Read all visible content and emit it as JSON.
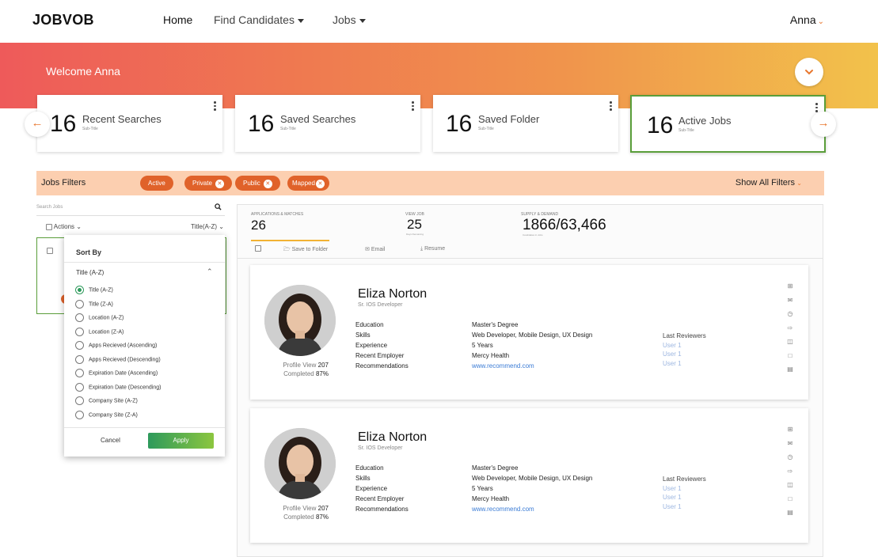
{
  "app": {
    "logo": "JOBVOB"
  },
  "nav": {
    "items": [
      {
        "label": "Home"
      },
      {
        "label": "Find Candidates"
      },
      {
        "label": "Jobs"
      }
    ],
    "user": "Anna"
  },
  "banner": {
    "welcome": "Welcome Anna"
  },
  "cards": [
    {
      "number": "16",
      "title": "Recent Searches",
      "sub": "Sub-Title"
    },
    {
      "number": "16",
      "title": "Saved Searches",
      "sub": "Sub-Title"
    },
    {
      "number": "16",
      "title": "Saved Folder",
      "sub": "Sub-Title"
    },
    {
      "number": "16",
      "title": "Active Jobs",
      "sub": "Sub-Title"
    }
  ],
  "filters": {
    "label": "Jobs Filters",
    "chips": [
      "Active",
      "Private",
      "Public",
      "Mapped"
    ],
    "show_all": "Show All Filters"
  },
  "left": {
    "search_placeholder": "Search Jobs",
    "actions": "Actions",
    "sort_current": "Title(A-Z)"
  },
  "sort": {
    "header": "Sort By",
    "current": "Title (A-Z)",
    "options": [
      "Title (A-Z)",
      "Title (Z-A)",
      "Location (A-Z)",
      "Location (Z-A)",
      "Apps Recieved (Ascending)",
      "Apps Recieved (Descending)",
      "Expiration Date (Ascending)",
      "Expiration Date (Descending)",
      "Company Site (A-Z)",
      "Company Site (Z-A)"
    ],
    "selected_index": 0,
    "cancel": "Cancel",
    "apply": "Apply"
  },
  "stats": {
    "apps_label": "APPLICATIONS & MATCHES",
    "apps_value": "26",
    "view_label": "VIEW JOB",
    "view_value": "25",
    "view_sub": "Days Remaining",
    "supply_label": "SUPPLY & DEMAND",
    "supply_value": "1866/63,466",
    "supply_sub": "Candidates in Jobs"
  },
  "toolbar": {
    "save": "Save to Folder",
    "email": "Email",
    "resume": "Resume"
  },
  "candidates": [
    {
      "name": "Eliza Norton",
      "role": "Sr. IOS Developer",
      "profile_view_label": "Profile View",
      "profile_view": "207",
      "completed_label": "Completed",
      "completed": "87%",
      "fields": [
        "Education",
        "Skills",
        "Experience",
        "Recent Employer",
        "Recommendations"
      ],
      "values": [
        "Master's Degree",
        "Web Developer, Mobile Design, UX Design",
        "5 Years",
        "Mercy Health",
        "www.recommend.com"
      ],
      "reviewers_label": "Last Reviewers",
      "reviewers": [
        "User 1",
        "User 1",
        "User 1"
      ]
    },
    {
      "name": "Eliza Norton",
      "role": "Sr. IOS Developer",
      "profile_view_label": "Profile View",
      "profile_view": "207",
      "completed_label": "Completed",
      "completed": "87%",
      "fields": [
        "Education",
        "Skills",
        "Experience",
        "Recent Employer",
        "Recommendations"
      ],
      "values": [
        "Master's Degree",
        "Web Developer, Mobile Design, UX Design",
        "5 Years",
        "Mercy Health",
        "www.recommend.com"
      ],
      "reviewers_label": "Last Reviewers",
      "reviewers": [
        "User 1",
        "User 1",
        "User 1"
      ]
    }
  ],
  "colors": {
    "accent": "#e0622a",
    "selected_border": "#5a9e3a",
    "apply_start": "#2e9a5c",
    "apply_end": "#8cc63f"
  }
}
